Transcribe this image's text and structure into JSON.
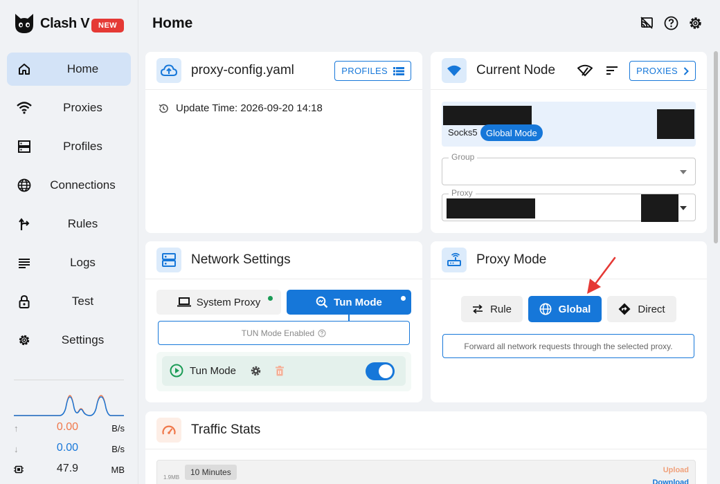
{
  "app": {
    "name": "Clash V",
    "badge": "NEW"
  },
  "sidebar": {
    "items": [
      {
        "label": "Home",
        "icon": "home-icon",
        "active": true
      },
      {
        "label": "Proxies",
        "icon": "wifi-icon"
      },
      {
        "label": "Profiles",
        "icon": "server-icon"
      },
      {
        "label": "Connections",
        "icon": "globe-icon"
      },
      {
        "label": "Rules",
        "icon": "fork-arrow-icon"
      },
      {
        "label": "Logs",
        "icon": "lines-icon"
      },
      {
        "label": "Test",
        "icon": "lock-icon"
      },
      {
        "label": "Settings",
        "icon": "gear-icon"
      }
    ],
    "stats": {
      "upload": {
        "value": "0.00",
        "unit": "B/s",
        "color": "#f0784a"
      },
      "download": {
        "value": "0.00",
        "unit": "B/s",
        "color": "#1677d9"
      },
      "memory": {
        "value": "47.9",
        "unit": "MB"
      }
    }
  },
  "header": {
    "title": "Home"
  },
  "profile_card": {
    "title": "proxy-config.yaml",
    "button": "PROFILES",
    "update_label": "Update Time: 2026-09-20 14:18"
  },
  "node_card": {
    "title": "Current Node",
    "button": "PROXIES",
    "node_type": "Socks5",
    "mode_pill": "Global Mode",
    "group_label": "Group",
    "proxy_label": "Proxy"
  },
  "network_card": {
    "title": "Network Settings",
    "system_proxy": "System Proxy",
    "tun_mode": "Tun Mode",
    "tun_note": "TUN Mode Enabled",
    "tun_row_label": "Tun Mode",
    "tun_enabled": true
  },
  "mode_card": {
    "title": "Proxy Mode",
    "modes": [
      "Rule",
      "Global",
      "Direct"
    ],
    "selected": "Global",
    "note": "Forward all network requests through the selected proxy."
  },
  "traffic_card": {
    "title": "Traffic Stats",
    "range_tab": "10 Minutes",
    "y_tick": "1.9MB",
    "legend_upload": "Upload",
    "legend_download": "Download"
  },
  "colors": {
    "accent": "#1677d9",
    "success": "#1a9b55",
    "danger": "#e53935"
  }
}
